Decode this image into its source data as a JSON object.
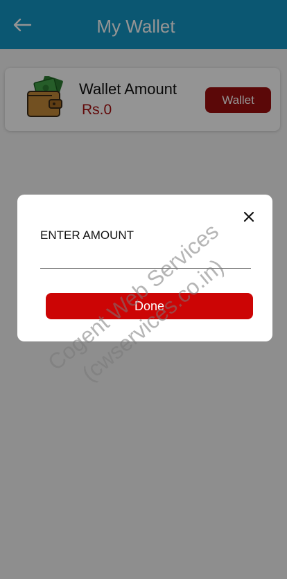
{
  "app_bar": {
    "title": "My Wallet",
    "back_icon": "arrow-left-icon",
    "color": "#1496c4"
  },
  "wallet_card": {
    "icon": "wallet-icon",
    "title": "Wallet Amount",
    "amount": "Rs.0",
    "button_label": "Wallet",
    "button_color": "#9e0f0f"
  },
  "dialog": {
    "close_icon": "close-icon",
    "label": "ENTER AMOUNT",
    "input_value": "",
    "done_label": "Done",
    "done_color": "#cc0505"
  },
  "watermark": {
    "line1": "Cogent Web Services",
    "line2": "(cwservices.co.in)"
  }
}
